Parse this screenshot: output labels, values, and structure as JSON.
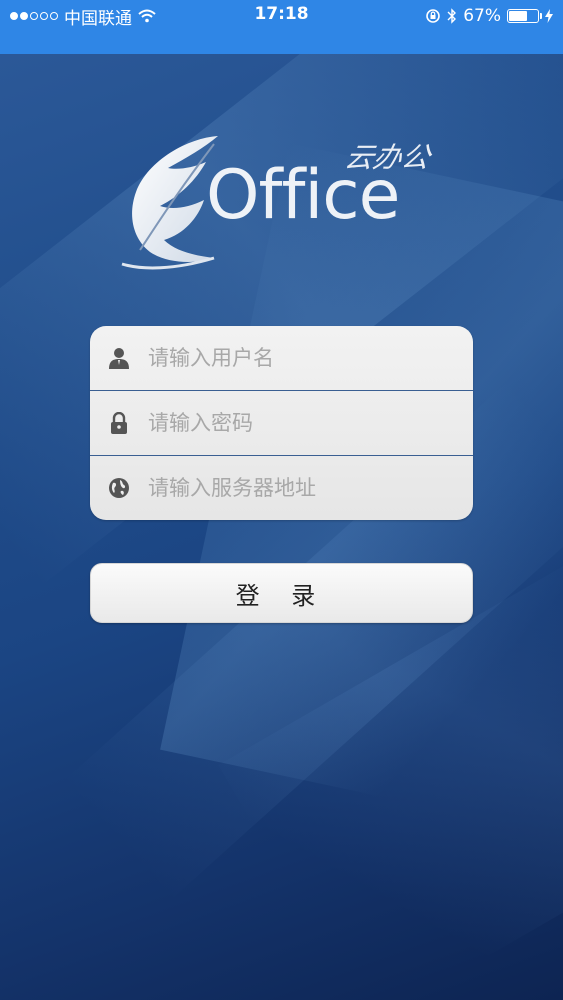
{
  "status_bar": {
    "carrier": "中国联通",
    "time": "17:18",
    "battery_percent": "67%",
    "battery_level": 0.67,
    "signal_bars_filled": 2,
    "signal_bars_total": 5
  },
  "logo": {
    "word": "Office",
    "subtitle": "云办公"
  },
  "form": {
    "username_placeholder": "请输入用户名",
    "password_placeholder": "请输入密码",
    "server_placeholder": "请输入服务器地址"
  },
  "login_button": {
    "label": "登 录"
  },
  "colors": {
    "status_bar_bg": "#2f86e6",
    "background": "#1b4583",
    "divider": "#3a5f92"
  }
}
